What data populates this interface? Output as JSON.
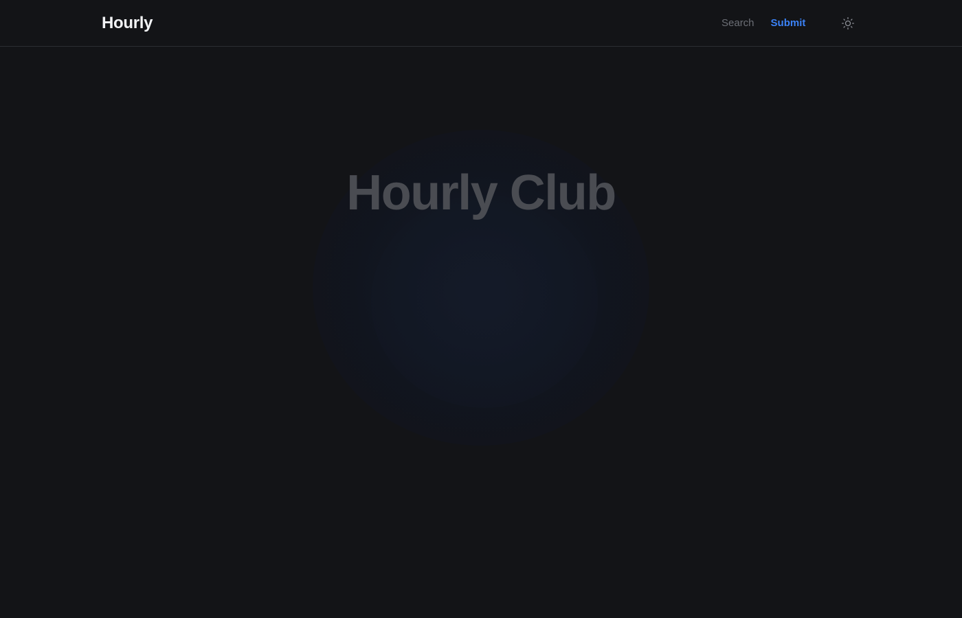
{
  "header": {
    "brand": "Hourly",
    "nav": {
      "search_label": "Search",
      "submit_label": "Submit"
    },
    "theme_toggle_icon": "sun-icon"
  },
  "hero": {
    "title": "Hourly Club"
  },
  "colors": {
    "background": "#131417",
    "brand_text": "#f2f3f5",
    "muted_link": "#6c6f76",
    "accent": "#3b82f6",
    "hero_title": "#4a4c52",
    "divider": "#2c2e33"
  }
}
